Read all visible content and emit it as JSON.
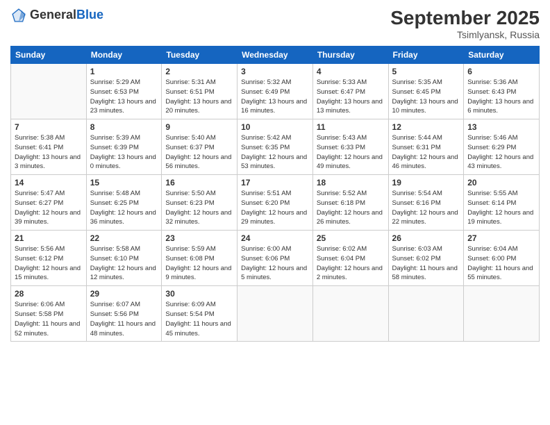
{
  "header": {
    "logo_general": "General",
    "logo_blue": "Blue",
    "month": "September 2025",
    "location": "Tsimlyansk, Russia"
  },
  "weekdays": [
    "Sunday",
    "Monday",
    "Tuesday",
    "Wednesday",
    "Thursday",
    "Friday",
    "Saturday"
  ],
  "weeks": [
    [
      {
        "day": "",
        "empty": true
      },
      {
        "day": "1",
        "sunrise": "Sunrise: 5:29 AM",
        "sunset": "Sunset: 6:53 PM",
        "daylight": "Daylight: 13 hours and 23 minutes."
      },
      {
        "day": "2",
        "sunrise": "Sunrise: 5:31 AM",
        "sunset": "Sunset: 6:51 PM",
        "daylight": "Daylight: 13 hours and 20 minutes."
      },
      {
        "day": "3",
        "sunrise": "Sunrise: 5:32 AM",
        "sunset": "Sunset: 6:49 PM",
        "daylight": "Daylight: 13 hours and 16 minutes."
      },
      {
        "day": "4",
        "sunrise": "Sunrise: 5:33 AM",
        "sunset": "Sunset: 6:47 PM",
        "daylight": "Daylight: 13 hours and 13 minutes."
      },
      {
        "day": "5",
        "sunrise": "Sunrise: 5:35 AM",
        "sunset": "Sunset: 6:45 PM",
        "daylight": "Daylight: 13 hours and 10 minutes."
      },
      {
        "day": "6",
        "sunrise": "Sunrise: 5:36 AM",
        "sunset": "Sunset: 6:43 PM",
        "daylight": "Daylight: 13 hours and 6 minutes."
      }
    ],
    [
      {
        "day": "7",
        "sunrise": "Sunrise: 5:38 AM",
        "sunset": "Sunset: 6:41 PM",
        "daylight": "Daylight: 13 hours and 3 minutes."
      },
      {
        "day": "8",
        "sunrise": "Sunrise: 5:39 AM",
        "sunset": "Sunset: 6:39 PM",
        "daylight": "Daylight: 13 hours and 0 minutes."
      },
      {
        "day": "9",
        "sunrise": "Sunrise: 5:40 AM",
        "sunset": "Sunset: 6:37 PM",
        "daylight": "Daylight: 12 hours and 56 minutes."
      },
      {
        "day": "10",
        "sunrise": "Sunrise: 5:42 AM",
        "sunset": "Sunset: 6:35 PM",
        "daylight": "Daylight: 12 hours and 53 minutes."
      },
      {
        "day": "11",
        "sunrise": "Sunrise: 5:43 AM",
        "sunset": "Sunset: 6:33 PM",
        "daylight": "Daylight: 12 hours and 49 minutes."
      },
      {
        "day": "12",
        "sunrise": "Sunrise: 5:44 AM",
        "sunset": "Sunset: 6:31 PM",
        "daylight": "Daylight: 12 hours and 46 minutes."
      },
      {
        "day": "13",
        "sunrise": "Sunrise: 5:46 AM",
        "sunset": "Sunset: 6:29 PM",
        "daylight": "Daylight: 12 hours and 43 minutes."
      }
    ],
    [
      {
        "day": "14",
        "sunrise": "Sunrise: 5:47 AM",
        "sunset": "Sunset: 6:27 PM",
        "daylight": "Daylight: 12 hours and 39 minutes."
      },
      {
        "day": "15",
        "sunrise": "Sunrise: 5:48 AM",
        "sunset": "Sunset: 6:25 PM",
        "daylight": "Daylight: 12 hours and 36 minutes."
      },
      {
        "day": "16",
        "sunrise": "Sunrise: 5:50 AM",
        "sunset": "Sunset: 6:23 PM",
        "daylight": "Daylight: 12 hours and 32 minutes."
      },
      {
        "day": "17",
        "sunrise": "Sunrise: 5:51 AM",
        "sunset": "Sunset: 6:20 PM",
        "daylight": "Daylight: 12 hours and 29 minutes."
      },
      {
        "day": "18",
        "sunrise": "Sunrise: 5:52 AM",
        "sunset": "Sunset: 6:18 PM",
        "daylight": "Daylight: 12 hours and 26 minutes."
      },
      {
        "day": "19",
        "sunrise": "Sunrise: 5:54 AM",
        "sunset": "Sunset: 6:16 PM",
        "daylight": "Daylight: 12 hours and 22 minutes."
      },
      {
        "day": "20",
        "sunrise": "Sunrise: 5:55 AM",
        "sunset": "Sunset: 6:14 PM",
        "daylight": "Daylight: 12 hours and 19 minutes."
      }
    ],
    [
      {
        "day": "21",
        "sunrise": "Sunrise: 5:56 AM",
        "sunset": "Sunset: 6:12 PM",
        "daylight": "Daylight: 12 hours and 15 minutes."
      },
      {
        "day": "22",
        "sunrise": "Sunrise: 5:58 AM",
        "sunset": "Sunset: 6:10 PM",
        "daylight": "Daylight: 12 hours and 12 minutes."
      },
      {
        "day": "23",
        "sunrise": "Sunrise: 5:59 AM",
        "sunset": "Sunset: 6:08 PM",
        "daylight": "Daylight: 12 hours and 9 minutes."
      },
      {
        "day": "24",
        "sunrise": "Sunrise: 6:00 AM",
        "sunset": "Sunset: 6:06 PM",
        "daylight": "Daylight: 12 hours and 5 minutes."
      },
      {
        "day": "25",
        "sunrise": "Sunrise: 6:02 AM",
        "sunset": "Sunset: 6:04 PM",
        "daylight": "Daylight: 12 hours and 2 minutes."
      },
      {
        "day": "26",
        "sunrise": "Sunrise: 6:03 AM",
        "sunset": "Sunset: 6:02 PM",
        "daylight": "Daylight: 11 hours and 58 minutes."
      },
      {
        "day": "27",
        "sunrise": "Sunrise: 6:04 AM",
        "sunset": "Sunset: 6:00 PM",
        "daylight": "Daylight: 11 hours and 55 minutes."
      }
    ],
    [
      {
        "day": "28",
        "sunrise": "Sunrise: 6:06 AM",
        "sunset": "Sunset: 5:58 PM",
        "daylight": "Daylight: 11 hours and 52 minutes."
      },
      {
        "day": "29",
        "sunrise": "Sunrise: 6:07 AM",
        "sunset": "Sunset: 5:56 PM",
        "daylight": "Daylight: 11 hours and 48 minutes."
      },
      {
        "day": "30",
        "sunrise": "Sunrise: 6:09 AM",
        "sunset": "Sunset: 5:54 PM",
        "daylight": "Daylight: 11 hours and 45 minutes."
      },
      {
        "day": "",
        "empty": true
      },
      {
        "day": "",
        "empty": true
      },
      {
        "day": "",
        "empty": true
      },
      {
        "day": "",
        "empty": true
      }
    ]
  ]
}
